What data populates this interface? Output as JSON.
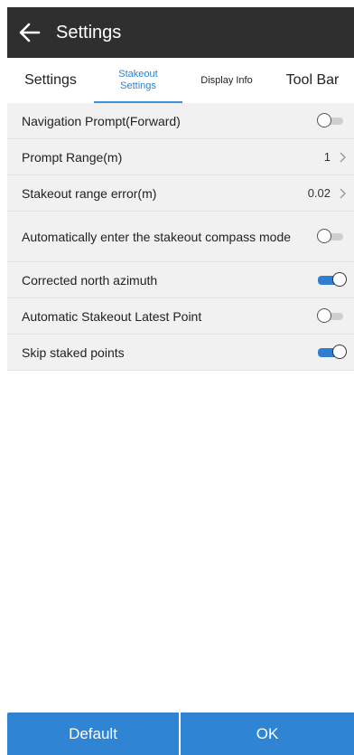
{
  "header": {
    "title": "Settings"
  },
  "tabs": [
    {
      "label": "Settings"
    },
    {
      "label": "Stakeout Settings"
    },
    {
      "label": "Display Info"
    },
    {
      "label": "Tool Bar"
    }
  ],
  "settings": [
    {
      "label": "Navigation Prompt(Forward)",
      "type": "toggle",
      "state": "off"
    },
    {
      "label": "Prompt Range(m)",
      "type": "value",
      "value": "1"
    },
    {
      "label": "Stakeout range error(m)",
      "type": "value",
      "value": "0.02"
    },
    {
      "label": "Automatically enter the stakeout compass mode",
      "type": "toggle",
      "state": "off"
    },
    {
      "label": "Corrected north azimuth",
      "type": "toggle",
      "state": "on"
    },
    {
      "label": "Automatic Stakeout Latest Point",
      "type": "toggle",
      "state": "off"
    },
    {
      "label": "Skip staked points",
      "type": "toggle",
      "state": "on"
    }
  ],
  "footer": {
    "default_label": "Default",
    "ok_label": "OK"
  },
  "colors": {
    "titlebar": "#2f2f2f",
    "accent": "#2f84d3",
    "list_background": "#f1f1f1"
  },
  "icons": {
    "back": "arrow-left-icon",
    "chevron": "chevron-right-icon"
  }
}
